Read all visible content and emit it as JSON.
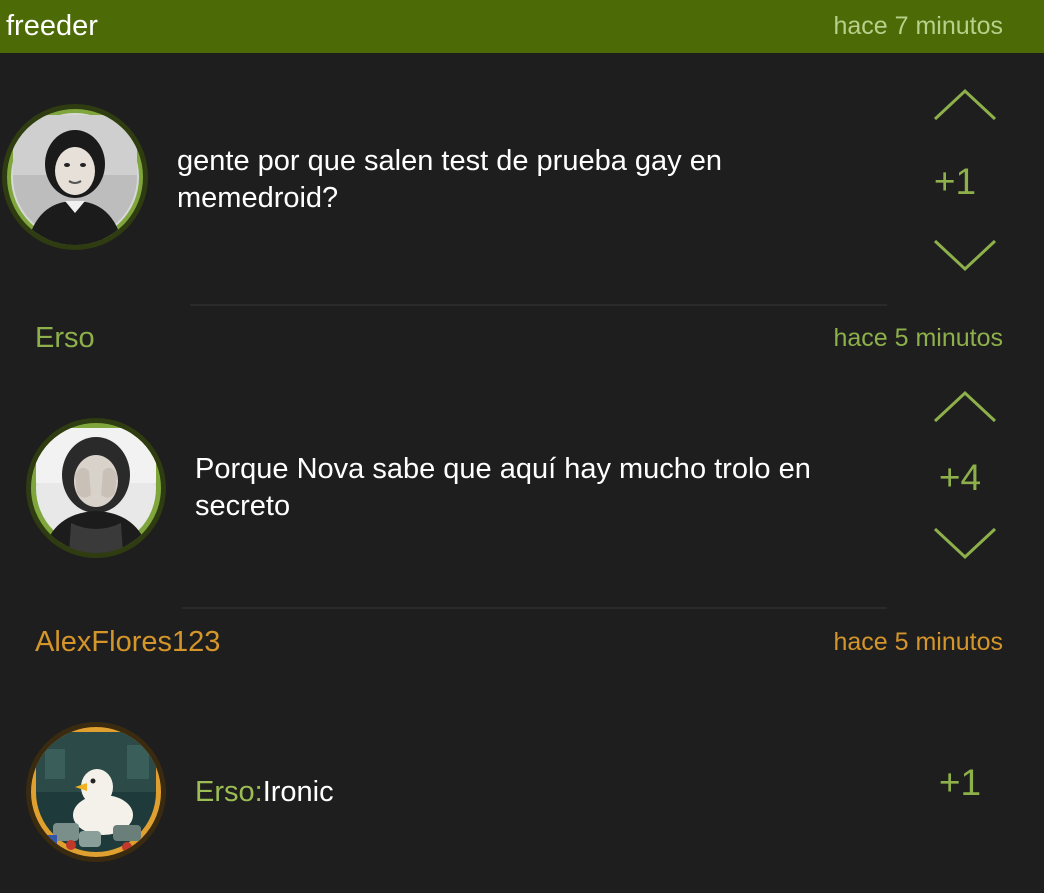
{
  "comments": [
    {
      "username": "freeder",
      "time": "hace 7 minutos",
      "text": "gente por que salen test de prueba gay en memedroid?",
      "score": "+1",
      "avatar_icon": "avatar-photo-girl-bw",
      "username_color": "#ffffff",
      "accent_color": "#4c6a06"
    },
    {
      "username": "Erso",
      "time": "hace 5 minutos",
      "text": "Porque Nova sabe que aquí hay mucho trolo en secreto",
      "score": "+4",
      "avatar_icon": "avatar-photo-woman-bw",
      "username_color": "#8db04a"
    },
    {
      "username": "AlexFlores123",
      "time": "hace 5 minutos",
      "mention": "Erso:",
      "text": "Ironic",
      "score": "+1",
      "avatar_icon": "avatar-duck-illustration",
      "username_color": "#d4952a"
    }
  ],
  "icons": {
    "upvote": "chevron-up-icon",
    "downvote": "chevron-down-icon"
  },
  "colors": {
    "background": "#1e1e1e",
    "highlight_bar": "#4c6a06",
    "accent_green": "#8db04a",
    "accent_orange": "#d4952a"
  }
}
